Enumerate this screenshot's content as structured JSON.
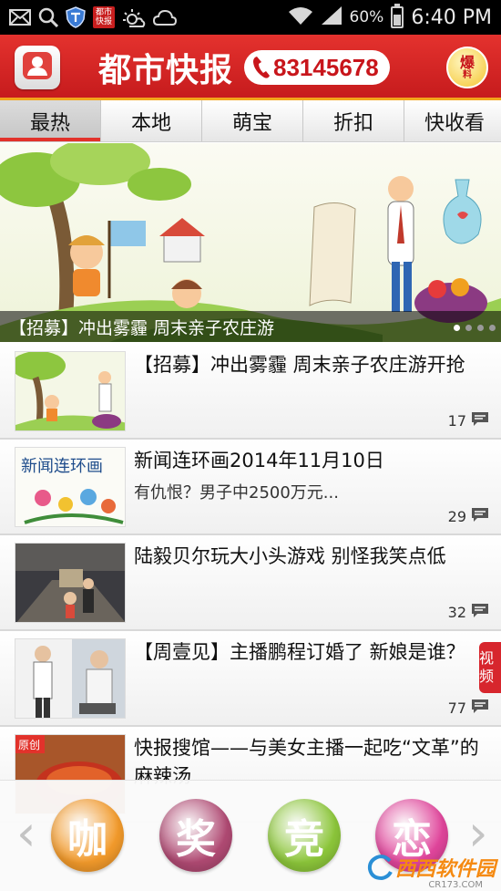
{
  "status_bar": {
    "icons": [
      "mail-icon",
      "search-icon",
      "shield-icon",
      "app-badge-icon",
      "weather-sun-icon",
      "cloud-icon",
      "wifi-icon",
      "signal-icon",
      "battery-icon"
    ],
    "badge_text": "都市快报",
    "battery_percent": "60%",
    "battery_level": 0.6,
    "time": "6:40 PM"
  },
  "header": {
    "logo_text": "都市快报",
    "hotline": "83145678",
    "baoliao_top": "爆",
    "baoliao_bottom": "料",
    "brand_color": "#d42524"
  },
  "tabs": [
    {
      "label": "最热",
      "active": true
    },
    {
      "label": "本地",
      "active": false
    },
    {
      "label": "萌宝",
      "active": false
    },
    {
      "label": "折扣",
      "active": false
    },
    {
      "label": "快收看",
      "active": false
    }
  ],
  "banner": {
    "caption": "【招募】冲出雾霾 周末亲子农庄游",
    "page_count": 4,
    "active_page": 1
  },
  "news": [
    {
      "title": "【招募】冲出雾霾 周末亲子农庄游开抢",
      "subtitle": "",
      "comments": "17",
      "tag": ""
    },
    {
      "title": "新闻连环画2014年11月10日",
      "subtitle": "有仇恨？男子中2500万元...",
      "comments": "29",
      "tag": ""
    },
    {
      "title": "陆毅贝尔玩大小头游戏 别怪我笑点低",
      "subtitle": "",
      "comments": "32",
      "tag": ""
    },
    {
      "title": "【周壹见】主播鹏程订婚了 新娘是谁？",
      "subtitle": "",
      "comments": "77",
      "tag": "视频"
    },
    {
      "title": "快报搜馆——与美女主播一起吃“文革”的麻辣汤",
      "subtitle": "",
      "comments": "",
      "tag": ""
    }
  ],
  "thumb_labels": {
    "comic_title": "新闻连环画",
    "original_tag": "原创"
  },
  "bottom_categories": [
    {
      "label": "咖",
      "color": "#f29a2b"
    },
    {
      "label": "奖",
      "color": "#b04a73"
    },
    {
      "label": "竞",
      "color": "#8cc63a"
    },
    {
      "label": "恋",
      "color": "#e0459b"
    }
  ],
  "watermark": {
    "main": "西西软件园",
    "sub": "CR173.COM"
  }
}
